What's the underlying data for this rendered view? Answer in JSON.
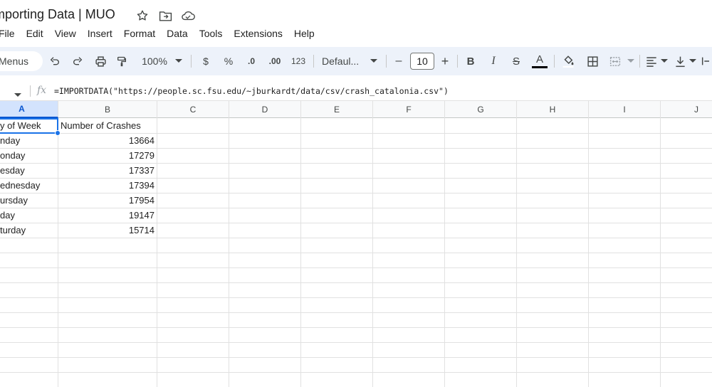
{
  "document": {
    "title": "mporting Data | MUO"
  },
  "title_icons": [
    {
      "name": "star-icon",
      "glyph": "☆"
    },
    {
      "name": "move-folder-icon",
      "glyph": "📁"
    },
    {
      "name": "cloud-status-icon",
      "glyph": "☁"
    }
  ],
  "menu": [
    "File",
    "Edit",
    "View",
    "Insert",
    "Format",
    "Data",
    "Tools",
    "Extensions",
    "Help"
  ],
  "toolbar": {
    "menus_label": "Menus",
    "zoom": "100%",
    "currency": "$",
    "percent": "%",
    "decrease_decimal": ".0",
    "increase_decimal": ".00",
    "number_format": "123",
    "font": "Defaul...",
    "font_size_minus": "–",
    "font_size": "10",
    "font_size_plus": "+",
    "bold": "B",
    "italic": "I",
    "strikethrough": "S",
    "text_color": "A"
  },
  "formula_bar": {
    "fx": "fx",
    "formula": "=IMPORTDATA(\"https://people.sc.fsu.edu/~jburkardt/data/csv/crash_catalonia.csv\")"
  },
  "columns": [
    "A",
    "B",
    "C",
    "D",
    "E",
    "F",
    "G",
    "H",
    "I",
    "J"
  ],
  "rows": [
    {
      "a": "y of Week",
      "b": "Number of Crashes"
    },
    {
      "a": "nday",
      "b": "13664"
    },
    {
      "a": "onday",
      "b": "17279"
    },
    {
      "a": "esday",
      "b": "17337"
    },
    {
      "a": "ednesday",
      "b": "17394"
    },
    {
      "a": "ursday",
      "b": "17954"
    },
    {
      "a": "day",
      "b": "19147"
    },
    {
      "a": "turday",
      "b": "15714"
    }
  ],
  "colors": {
    "toolbar_bg": "#edf2fa",
    "selection": "#1a73e8",
    "selected_header_bg": "#d3e3fd"
  }
}
